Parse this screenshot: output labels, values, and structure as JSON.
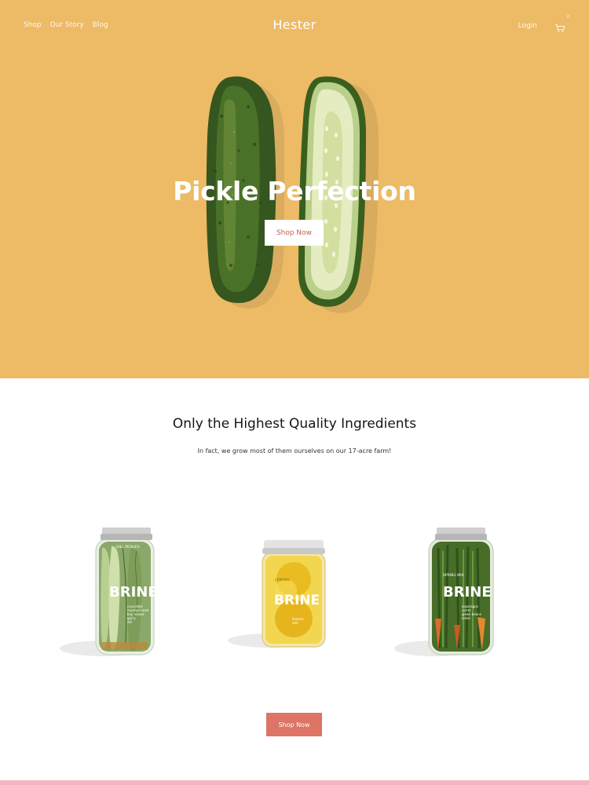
{
  "nav": {
    "links": [
      "Shop",
      "Our Story",
      "Blog"
    ],
    "brand": "Hester",
    "login": "Login",
    "cart_count": "0"
  },
  "hero": {
    "title": "Pickle Perfection",
    "button": "Shop Now"
  },
  "ingredients": {
    "title": "Only the Highest Quality Ingredients",
    "subtitle": "In fact, we grow most of them ourselves on our 17-acre farm!"
  },
  "products": [
    {
      "name": "DILL PICKLES",
      "brand": "BRINE",
      "ingredients": [
        "cucumber",
        "mustard seed",
        "bay leaves",
        "garlic",
        "dill"
      ]
    },
    {
      "name": "LEMONS",
      "brand": "BRINE",
      "ingredients": [
        "lemons",
        "salt"
      ]
    },
    {
      "name": "SPRING MIX",
      "brand": "BRINE",
      "ingredients": [
        "asparagus",
        "carrot",
        "green beans",
        "onion"
      ]
    }
  ],
  "cta": {
    "button": "Shop Now"
  },
  "colors": {
    "hero_bg": "#edba66",
    "accent_button": "#dd7465",
    "footer_strip": "#f3b4c3"
  }
}
